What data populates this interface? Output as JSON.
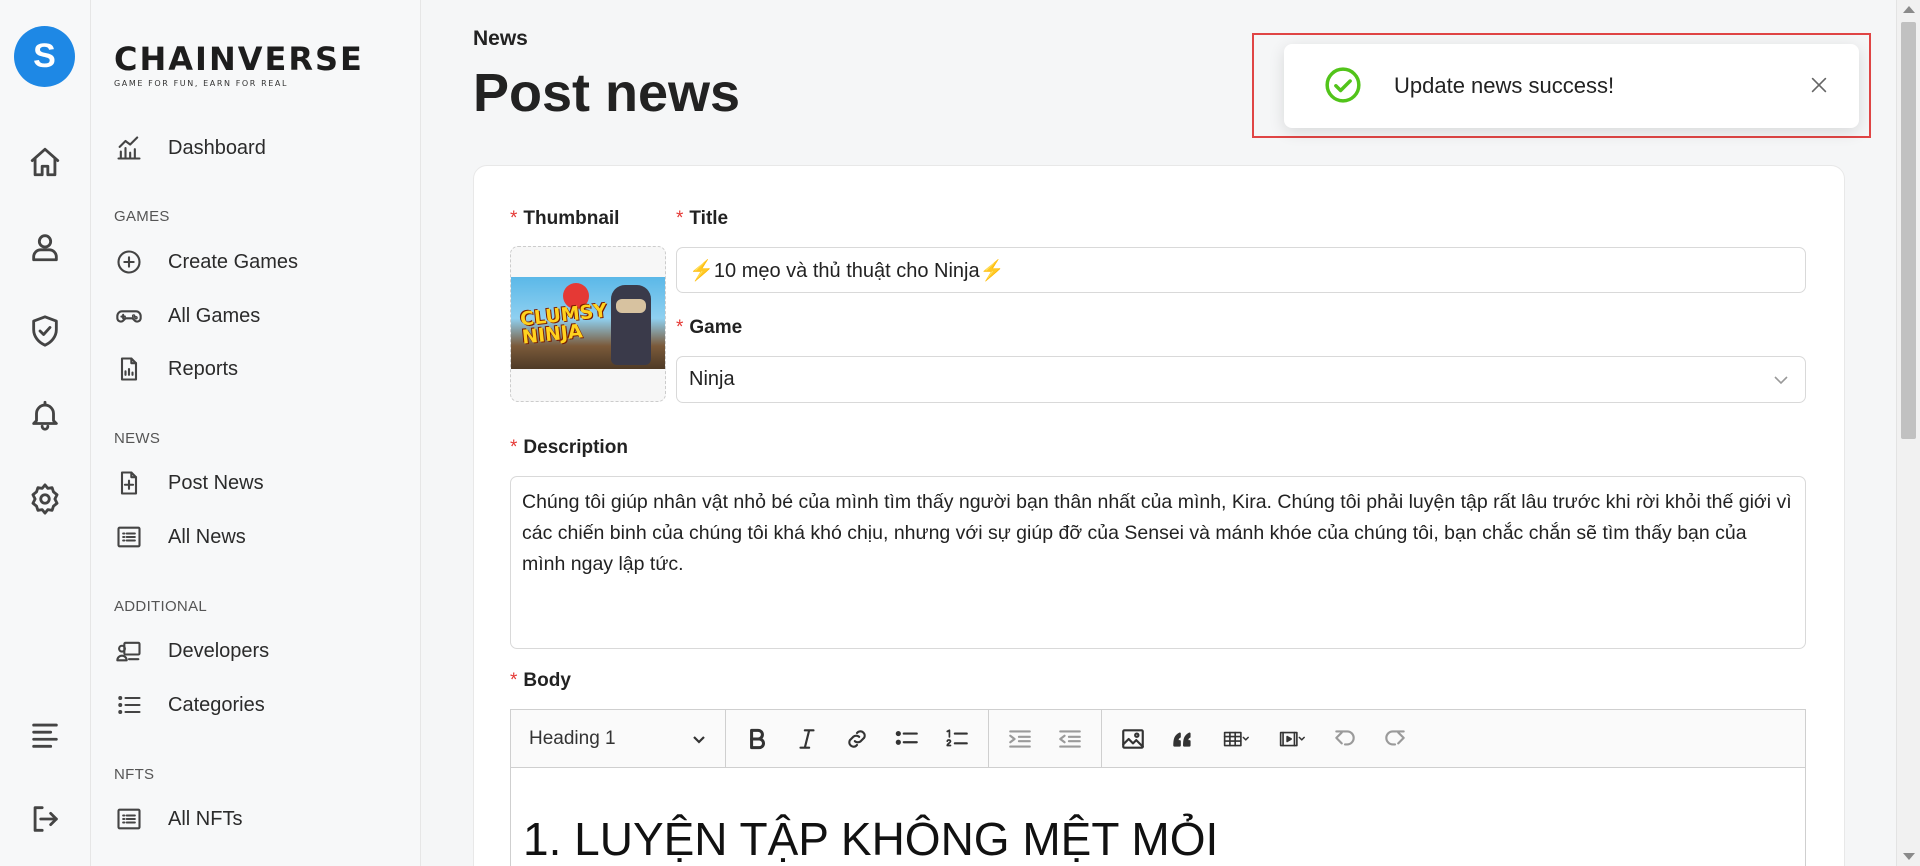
{
  "brand": {
    "name": "CHAINVERSE",
    "tagline": "GAME FOR FUN, EARN FOR REAL"
  },
  "rail": {
    "icons": [
      "home-icon",
      "user-icon",
      "shield-check-icon",
      "bell-icon",
      "gear-icon",
      "menu-icon",
      "logout-icon"
    ]
  },
  "nav": {
    "dashboard": "Dashboard",
    "sections": {
      "games": "GAMES",
      "news": "NEWS",
      "additional": "ADDITIONAL",
      "nfts": "NFTS"
    },
    "items": {
      "create_games": "Create Games",
      "all_games": "All Games",
      "reports": "Reports",
      "post_news": "Post News",
      "all_news": "All News",
      "developers": "Developers",
      "categories": "Categories",
      "all_nfts": "All NFTs"
    }
  },
  "page": {
    "breadcrumb": "News",
    "title": "Post news"
  },
  "form": {
    "required_mark": "*",
    "thumbnail_label": "Thumbnail",
    "thumbnail_art_text": "CLUMSY NINJA",
    "title_label": "Title",
    "title_value": "⚡10 mẹo và thủ thuật cho Ninja⚡",
    "game_label": "Game",
    "game_value": "Ninja",
    "description_label": "Description",
    "description_value": "Chúng tôi giúp nhân vật nhỏ bé của mình tìm thấy người bạn thân nhất của mình, Kira. Chúng tôi phải luyện tập rất lâu trước khi rời khỏi thế giới vì các chiến binh của chúng tôi khá khó chịu, nhưng với sự giúp đỡ của Sensei và mánh khóe của chúng tôi, bạn chắc chắn sẽ tìm thấy bạn của mình ngay lập tức.",
    "body_label": "Body",
    "heading_select": "Heading 1",
    "body_heading": "1. LUYỆN TẬP KHÔNG MỆT MỎI"
  },
  "toast": {
    "message": "Update news success!"
  },
  "colors": {
    "required": "#e53935",
    "success": "#52c41a",
    "highlight_border": "#e04545",
    "logo": "#1e88e5"
  }
}
